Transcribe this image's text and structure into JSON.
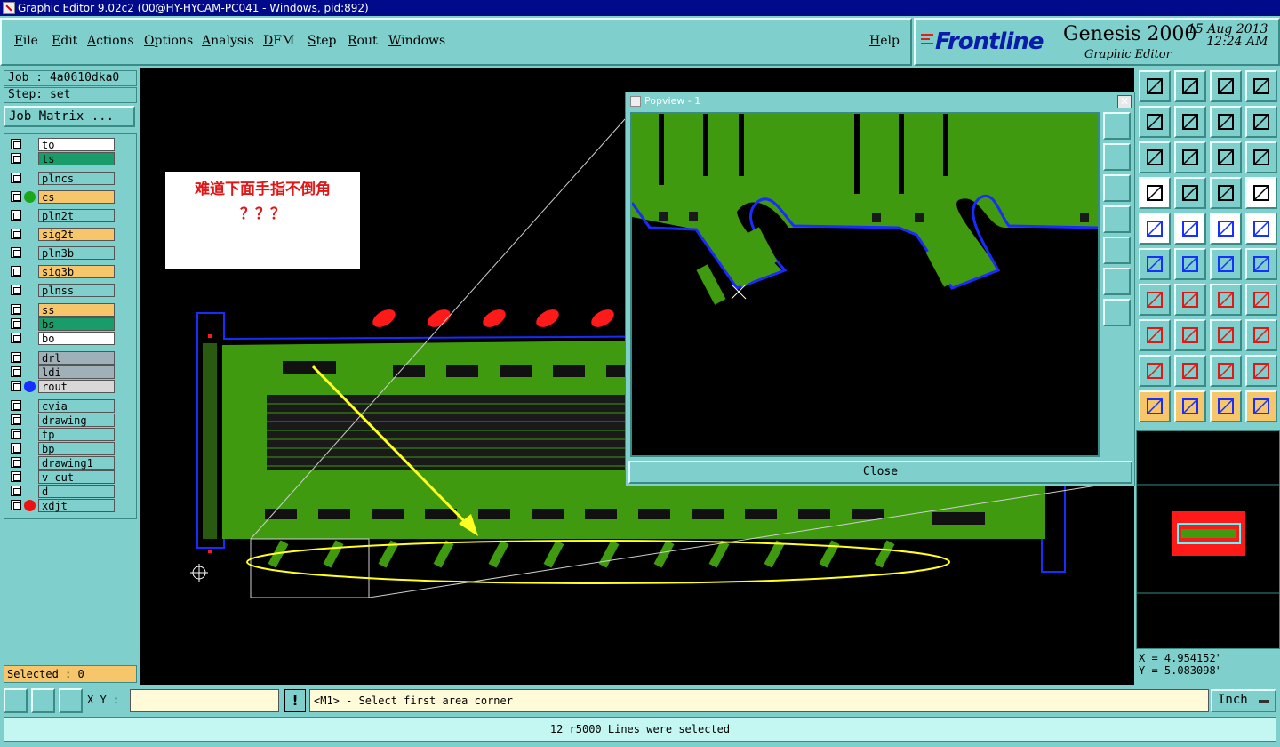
{
  "window": {
    "title": "Graphic Editor 9.02c2 (00@HY-HYCAM-PC041 - Windows, pid:892)"
  },
  "menu": {
    "items": [
      "File",
      "Edit",
      "Actions",
      "Options",
      "Analysis",
      "DFM",
      "Step",
      "Rout",
      "Windows"
    ],
    "help": "Help"
  },
  "brand": {
    "logo": "Frontline",
    "product": "Genesis 2000",
    "subtitle": "Graphic Editor",
    "date": "15 Aug 2013",
    "time": "12:24 AM"
  },
  "job": {
    "label": "Job : 4a0610dka0",
    "step": "Step: set",
    "matrix_button": "Job Matrix ..."
  },
  "layers": [
    {
      "name": "to",
      "bg": "#ffffff",
      "dot": null
    },
    {
      "name": "ts",
      "bg": "#1a9c6a",
      "dot": null
    },
    {
      "name": "plncs",
      "bg": "#7fd0cc",
      "dot": null
    },
    {
      "name": "cs",
      "bg": "#f7c66b",
      "dot": "#1aa81a"
    },
    {
      "name": "pln2t",
      "bg": "#7fd0cc",
      "dot": null
    },
    {
      "name": "sig2t",
      "bg": "#f7c66b",
      "dot": null
    },
    {
      "name": "pln3b",
      "bg": "#7fd0cc",
      "dot": null
    },
    {
      "name": "sig3b",
      "bg": "#f7c66b",
      "dot": null
    },
    {
      "name": "plnss",
      "bg": "#7fd0cc",
      "dot": null
    },
    {
      "name": "ss",
      "bg": "#f7c66b",
      "dot": null
    },
    {
      "name": "bs",
      "bg": "#1a9c6a",
      "dot": null
    },
    {
      "name": "bo",
      "bg": "#ffffff",
      "dot": null
    },
    {
      "name": "drl",
      "bg": "#a0b0b8",
      "dot": null
    },
    {
      "name": "ldi",
      "bg": "#a0b0b8",
      "dot": null
    },
    {
      "name": "rout",
      "bg": "#d8d8d8",
      "dot": "#1530ff"
    },
    {
      "name": "cvia",
      "bg": "#7fd0cc",
      "dot": null
    },
    {
      "name": "drawing",
      "bg": "#7fd0cc",
      "dot": null
    },
    {
      "name": "tp",
      "bg": "#7fd0cc",
      "dot": null
    },
    {
      "name": "bp",
      "bg": "#7fd0cc",
      "dot": null
    },
    {
      "name": "drawing1",
      "bg": "#7fd0cc",
      "dot": null
    },
    {
      "name": "v-cut",
      "bg": "#7fd0cc",
      "dot": null
    },
    {
      "name": "d",
      "bg": "#7fd0cc",
      "dot": null
    },
    {
      "name": "xdjt",
      "bg": "#7fd0cc",
      "dot": "#ee1111"
    }
  ],
  "selected": "Selected : 0",
  "annotation": {
    "line1": "难道下面手指不倒角",
    "line2": "？？？"
  },
  "popview": {
    "title": "Popview - 1",
    "close_label": "Close"
  },
  "coords": {
    "x": "X = 4.954152\"",
    "y": "Y = 5.083098\""
  },
  "command": {
    "xy_label": "X Y :",
    "xy_value": "",
    "bang": "!",
    "prompt": "<M1> - Select first area corner",
    "unit": "Inch"
  },
  "status": "12 r5000 Lines were selected",
  "colors": {
    "board": "#3f9a10",
    "rout": "#1a2bff",
    "highlight": "#ffff22",
    "pad_red": "#ff1a1a",
    "panel": "#7fd0cc"
  }
}
